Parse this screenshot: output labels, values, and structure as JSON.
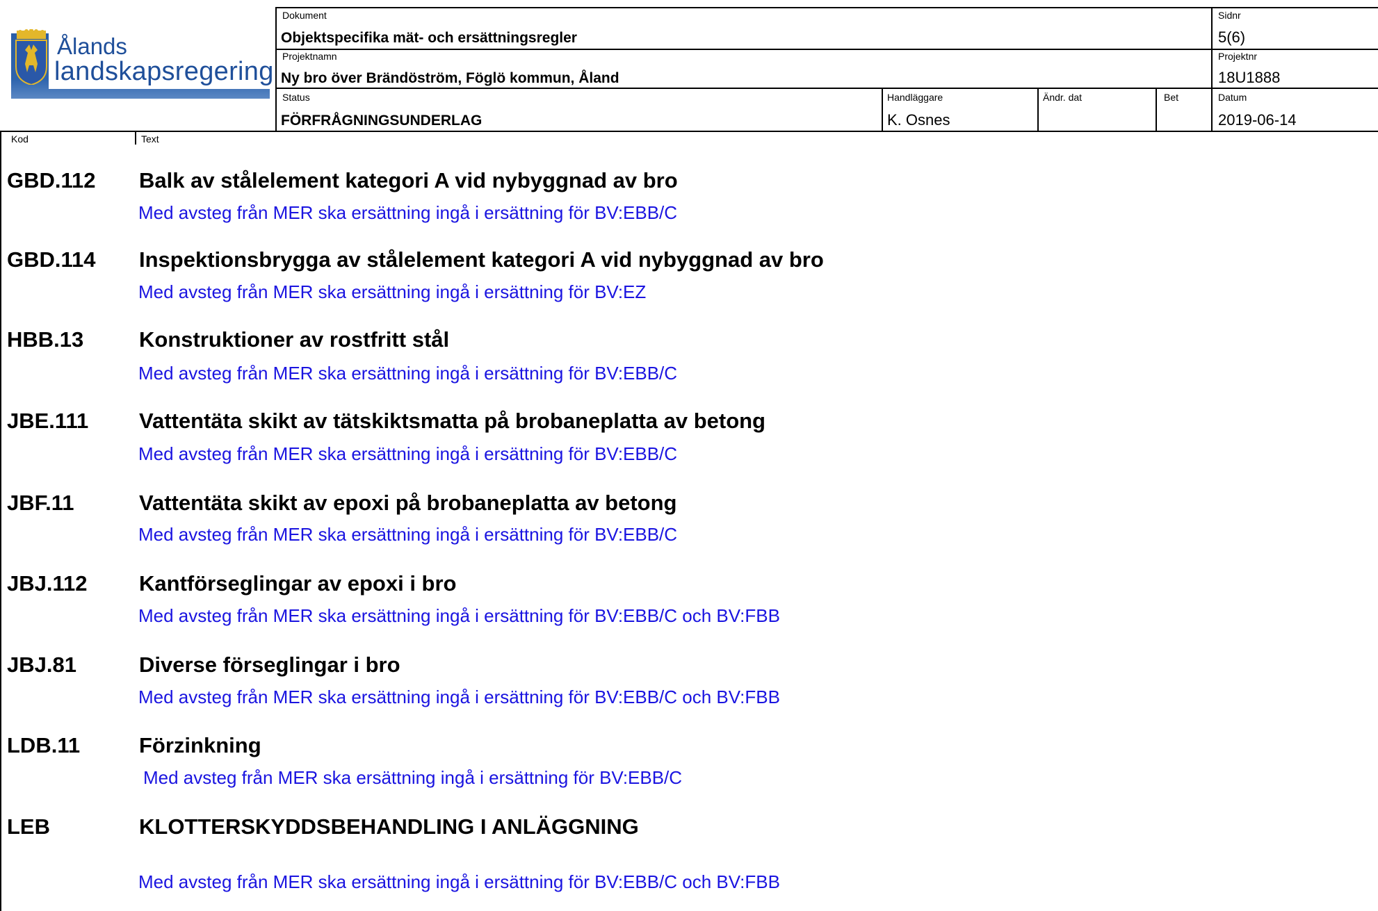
{
  "header": {
    "logo": {
      "line1": "Ålands",
      "line2": "landskapsregering"
    },
    "dokument_label": "Dokument",
    "dokument_value": "Objektspecifika mät- och ersättningsregler",
    "sidnr_label": "Sidnr",
    "sidnr_value": "5(6)",
    "projektnamn_label": "Projektnamn",
    "projektnamn_value": "Ny bro över Brändöström, Föglö kommun, Åland",
    "projektnr_label": "Projektnr",
    "projektnr_value": "18U1888",
    "status_label": "Status",
    "status_value": "FÖRFRÅGNINGSUNDERLAG",
    "handlaggare_label": "Handläggare",
    "handlaggare_value": "K. Osnes",
    "andr_dat_label": "Ändr. dat",
    "bet_label": "Bet",
    "datum_label": "Datum",
    "datum_value": "2019-06-14"
  },
  "columns": {
    "kod": "Kod",
    "text": "Text"
  },
  "entries": [
    {
      "code": "GBD.112",
      "title": "Balk av stålelement kategori A vid nybyggnad av bro",
      "note": "Med avsteg från MER ska ersättning ingå i ersättning för BV:EBB/C"
    },
    {
      "code": "GBD.114",
      "title": "Inspektionsbrygga av stålelement kategori A vid nybyggnad av bro",
      "note": "Med avsteg från MER ska ersättning ingå i ersättning för BV:EZ"
    },
    {
      "code": "HBB.13",
      "title": "Konstruktioner av rostfritt stål",
      "note": "Med avsteg från MER ska ersättning ingå i ersättning för BV:EBB/C"
    },
    {
      "code": "JBE.111",
      "title": "Vattentäta skikt av tätskiktsmatta på brobaneplatta av betong",
      "note": "Med avsteg från MER ska ersättning ingå i ersättning för BV:EBB/C"
    },
    {
      "code": "JBF.11",
      "title": "Vattentäta skikt av epoxi på brobaneplatta av betong",
      "note": "Med avsteg från MER ska ersättning ingå i ersättning för BV:EBB/C"
    },
    {
      "code": "JBJ.112",
      "title": "Kantförseglingar av epoxi i bro",
      "note": "Med avsteg från MER ska ersättning ingå i ersättning för BV:EBB/C och BV:FBB"
    },
    {
      "code": "JBJ.81",
      "title": "Diverse förseglingar i bro",
      "note": "Med avsteg från MER ska ersättning ingå i ersättning för BV:EBB/C och BV:FBB"
    },
    {
      "code": "LDB.11",
      "title": "Förzinkning",
      "note": "Med avsteg från MER ska ersättning ingå i ersättning för BV:EBB/C"
    },
    {
      "code": "LEB",
      "title": "KLOTTERSKYDDSBEHANDLING I ANLÄGGNING",
      "note": "Med avsteg från MER ska ersättning ingå i ersättning för BV:EBB/C och BV:FBB"
    }
  ]
}
